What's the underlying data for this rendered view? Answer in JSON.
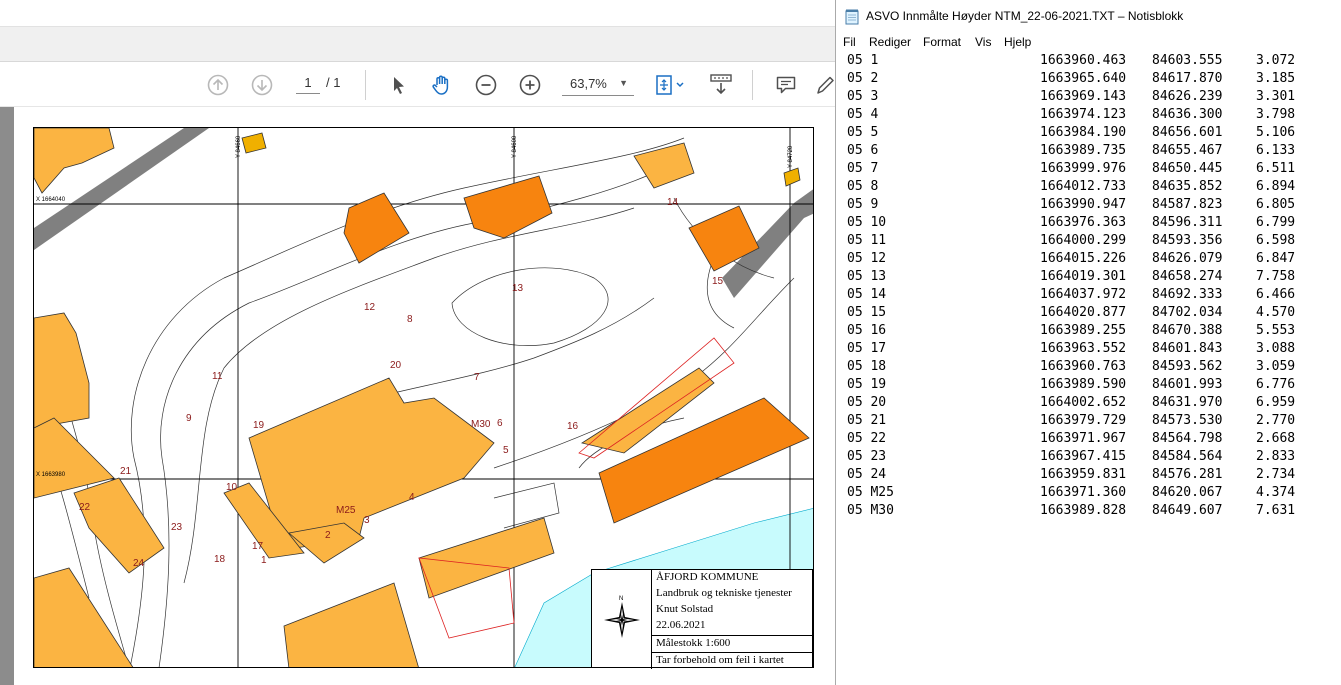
{
  "pdf_viewer": {
    "page_current": "1",
    "page_total": "/ 1",
    "zoom": "63,7%",
    "tools": {
      "prev_page": "arrow-up-circle-icon",
      "next_page": "arrow-down-circle-icon",
      "select": "pointer-icon",
      "hand": "hand-icon",
      "zoom_out": "zoom-out-icon",
      "zoom_in": "zoom-in-icon",
      "fit": "fit-page-icon",
      "scroll_mode": "scroll-mode-icon",
      "comment": "comment-icon",
      "pen": "pen-icon"
    },
    "map": {
      "grid_labels": [
        "X 1664040",
        "X 1663980",
        "Y 84660",
        "Y 84600",
        "Y 84720"
      ],
      "point_labels": [
        "1",
        "2",
        "3",
        "4",
        "5",
        "6",
        "7",
        "8",
        "9",
        "10",
        "11",
        "12",
        "13",
        "14",
        "15",
        "16",
        "17",
        "18",
        "19",
        "20",
        "21",
        "22",
        "23",
        "24",
        "M25",
        "M30"
      ],
      "title_block": {
        "line1": "ÅFJORD KOMMUNE",
        "line2": "Landbruk og tekniske tjenester",
        "line3": "Knut Solstad",
        "line4": "22.06.2021",
        "line5": "Målestokk 1:600",
        "line6": "Tar forbehold om feil i kartet"
      }
    }
  },
  "notepad": {
    "title": "ASVO Innmålte Høyder NTM_22-06-2021.TXT – Notisblokk",
    "menu": [
      "Fil",
      "Rediger",
      "Format",
      "Vis",
      "Hjelp"
    ],
    "rows": [
      [
        "05 1",
        "1663960.463",
        "84603.555",
        "3.072"
      ],
      [
        "05 2",
        "1663965.640",
        "84617.870",
        "3.185"
      ],
      [
        "05 3",
        "1663969.143",
        "84626.239",
        "3.301"
      ],
      [
        "05 4",
        "1663974.123",
        "84636.300",
        "3.798"
      ],
      [
        "05 5",
        "1663984.190",
        "84656.601",
        "5.106"
      ],
      [
        "05 6",
        "1663989.735",
        "84655.467",
        "6.133"
      ],
      [
        "05 7",
        "1663999.976",
        "84650.445",
        "6.511"
      ],
      [
        "05 8",
        "1664012.733",
        "84635.852",
        "6.894"
      ],
      [
        "05 9",
        "1663990.947",
        "84587.823",
        "6.805"
      ],
      [
        "05 10",
        "1663976.363",
        "84596.311",
        "6.799"
      ],
      [
        "05 11",
        "1664000.299",
        "84593.356",
        "6.598"
      ],
      [
        "05 12",
        "1664015.226",
        "84626.079",
        "6.847"
      ],
      [
        "05 13",
        "1664019.301",
        "84658.274",
        "7.758"
      ],
      [
        "05 14",
        "1664037.972",
        "84692.333",
        "6.466"
      ],
      [
        "05 15",
        "1664020.877",
        "84702.034",
        "4.570"
      ],
      [
        "05 16",
        "1663989.255",
        "84670.388",
        "5.553"
      ],
      [
        "05 17",
        "1663963.552",
        "84601.843",
        "3.088"
      ],
      [
        "05 18",
        "1663960.763",
        "84593.562",
        "3.059"
      ],
      [
        "05 19",
        "1663989.590",
        "84601.993",
        "6.776"
      ],
      [
        "05 20",
        "1664002.652",
        "84631.970",
        "6.959"
      ],
      [
        "05 21",
        "1663979.729",
        "84573.530",
        "2.770"
      ],
      [
        "05 22",
        "1663971.967",
        "84564.798",
        "2.668"
      ],
      [
        "05 23",
        "1663967.415",
        "84584.564",
        "2.833"
      ],
      [
        "05 24",
        "1663959.831",
        "84576.281",
        "2.734"
      ],
      [
        "05 M25",
        "1663971.360",
        "84620.067",
        "4.374"
      ],
      [
        "05 M30",
        "1663989.828",
        "84649.607",
        "7.631"
      ]
    ]
  },
  "colors": {
    "building_light": "#fbb442",
    "building_dark": "#f7840f",
    "road": "#808080",
    "water": "#c8fbfd",
    "label_red": "#8b1a1a"
  }
}
